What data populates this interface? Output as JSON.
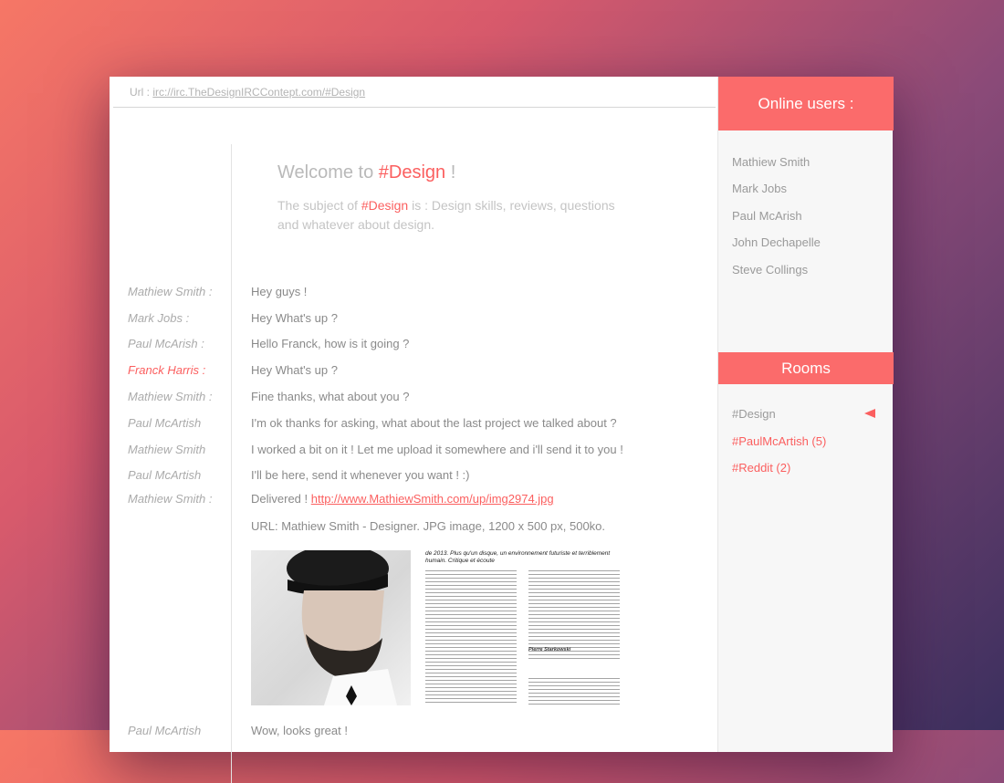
{
  "url_bar": {
    "label": "Url :",
    "link": "irc://irc.TheDesignIRCContept.com/#Design"
  },
  "welcome": {
    "prefix": "Welcome to ",
    "channel": "#Design",
    "suffix": " !",
    "subject_prefix": "The subject of ",
    "subject_channel": "#Design",
    "subject_text": " is : Design skills, reviews, questions and whatever about design."
  },
  "messages": [
    {
      "nick": "Mathiew Smith :",
      "text": "Hey guys !"
    },
    {
      "nick": "Mark Jobs :",
      "text": "Hey What's up ?"
    },
    {
      "nick": "Paul McArish :",
      "text": "Hello Franck, how is it going ?"
    },
    {
      "nick": "Franck Harris :",
      "text": "Hey What's up ?",
      "highlight": true
    },
    {
      "nick": "Mathiew Smith :",
      "text": "Fine thanks, what about you ?"
    },
    {
      "nick": "Paul McArtish",
      "text": "I'm ok thanks for asking, what about the last project we talked about ?"
    },
    {
      "nick": "Mathiew Smith",
      "text": "I worked a bit on it ! Let me upload it somewhere and i'll send it to you !"
    },
    {
      "nick": "Paul McArtish",
      "text": "I'll be here, send it whenever you want ! :)"
    }
  ],
  "delivered": {
    "nick": "Mathiew Smith :",
    "prefix": "Delivered ! ",
    "link": "http://www.MathiewSmith.com/up/img2974.jpg",
    "info": "URL: Mathiew Smith - Designer. JPG image, 1200 x 500 px, 500ko."
  },
  "preview": {
    "article_header": "de 2013. Plus qu'un disque, un environnement futuriste et terriblement humain. Critique et écoute",
    "signature": "Pierre Starkowski"
  },
  "partial": {
    "nick": "Paul McArtish",
    "text": "Wow, looks great !"
  },
  "sidebar": {
    "users_title": "Online users :",
    "users": [
      "Mathiew Smith",
      "Mark Jobs",
      "Paul McArish",
      "John Dechapelle",
      "Steve Collings"
    ],
    "rooms_title": "Rooms",
    "rooms": [
      {
        "name": "#Design",
        "active": true
      },
      {
        "name": "#PaulMcArtish (5)",
        "highlight": true
      },
      {
        "name": "#Reddit (2)",
        "highlight": true
      }
    ]
  },
  "colors": {
    "accent": "#fb5f5f",
    "header_bg": "#fb6b6b"
  }
}
